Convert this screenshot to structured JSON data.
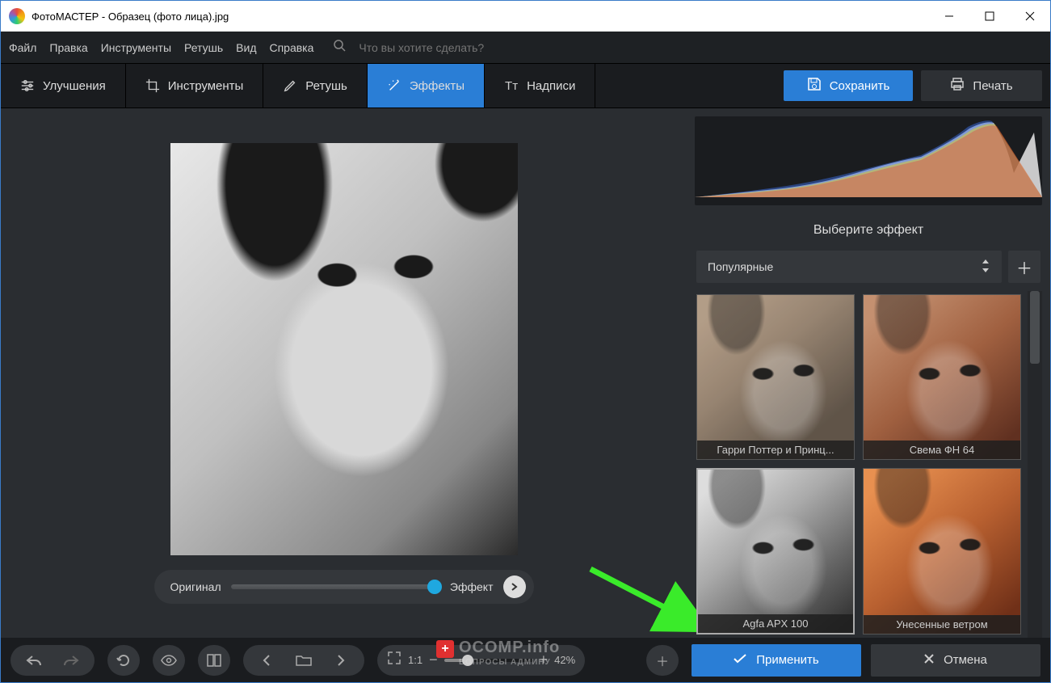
{
  "window": {
    "title": "ФотоМАСТЕР - Образец (фото лица).jpg"
  },
  "menu": {
    "items": [
      "Файл",
      "Правка",
      "Инструменты",
      "Ретушь",
      "Вид",
      "Справка"
    ],
    "search_placeholder": "Что вы хотите сделать?"
  },
  "tabs": {
    "items": [
      {
        "label": "Улучшения"
      },
      {
        "label": "Инструменты"
      },
      {
        "label": "Ретушь"
      },
      {
        "label": "Эффекты"
      },
      {
        "label": "Надписи"
      }
    ],
    "save": "Сохранить",
    "print": "Печать"
  },
  "canvas": {
    "original_label": "Оригинал",
    "effect_label": "Эффект"
  },
  "panel": {
    "title": "Выберите эффект",
    "category": "Популярные",
    "effects": [
      {
        "label": "Гарри Поттер и Принц..."
      },
      {
        "label": "Свема ФН 64"
      },
      {
        "label": "Agfa APX 100"
      },
      {
        "label": "Унесенные ветром"
      }
    ]
  },
  "footer": {
    "fit": "1:1",
    "zoom": "42%",
    "apply": "Применить",
    "cancel": "Отмена"
  },
  "watermark": {
    "line1": "OCOMP.info",
    "line2": "ВОПРОСЫ АДМИНУ"
  }
}
